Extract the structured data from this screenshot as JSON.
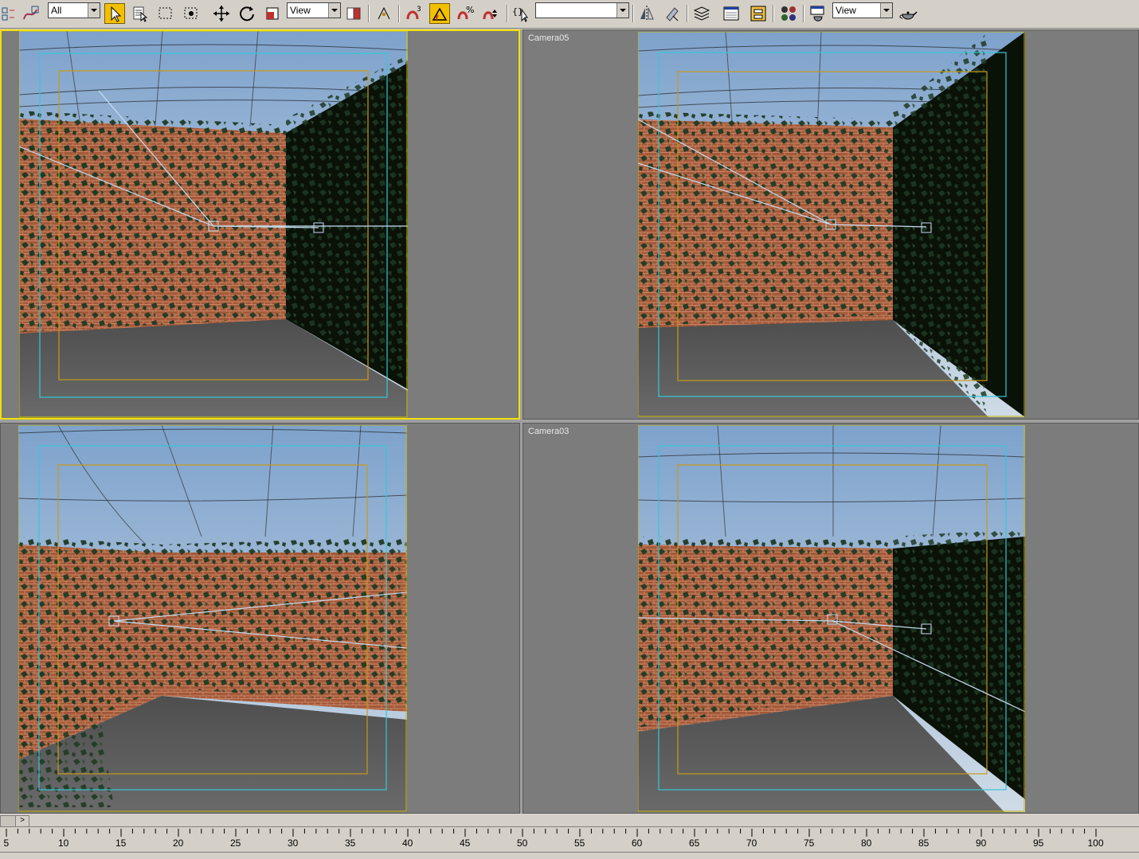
{
  "toolbar": {
    "selection_filter": "All",
    "reference_coord_system": "View",
    "named_selection_set": "",
    "render_view_mode": "View"
  },
  "viewports": {
    "top_left": {
      "label": ""
    },
    "top_right": {
      "label": "Camera05"
    },
    "bottom_left": {
      "label": ""
    },
    "bottom_right": {
      "label": "Camera03"
    }
  },
  "timeline": {
    "tick_labels": [
      "5",
      "10",
      "15",
      "20",
      "25",
      "30",
      "35",
      "40",
      "45",
      "50",
      "55",
      "60",
      "65",
      "70",
      "75",
      "80",
      "85",
      "90",
      "95",
      "100"
    ]
  },
  "trackbar": {
    "next_label": ">"
  },
  "colors": {
    "active_viewport_border": "#f0e000",
    "safe_frame_outer": "#34c8d8",
    "safe_frame_inner": "#c89a18",
    "sky_top": "#7ea2cc",
    "brick": "#a45a3a",
    "ivy": "#1e3a24",
    "floor": "#5e5e5e"
  }
}
